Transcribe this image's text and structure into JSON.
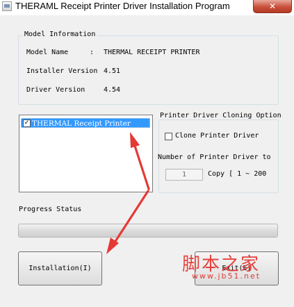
{
  "window": {
    "title": "THERAML Receipt Printer Driver Installation Program",
    "close_glyph": "✕"
  },
  "model_info": {
    "legend": "Model Information",
    "rows": [
      {
        "label": "Model Name",
        "sep": ":",
        "value": "THERMAL RECEIPT PRINTER"
      },
      {
        "label": "Installer Version",
        "value": "4.51"
      },
      {
        "label": "Driver Version",
        "value": "4.54"
      }
    ]
  },
  "printer_list": {
    "items": [
      {
        "label": "THERMAL Receipt Printer",
        "checked": true,
        "selected": true
      }
    ]
  },
  "cloning": {
    "legend": "Printer Driver Cloning Option",
    "clone_label": "Clone Printer Driver",
    "count_label": "Number of Printer Driver to",
    "count_value": "1",
    "copy_range": "Copy [ 1 ~ 200"
  },
  "progress": {
    "label": "Progress Status",
    "value": 0
  },
  "buttons": {
    "install": "Installation(I)",
    "exit": "Exit(E)"
  },
  "watermark": {
    "text": "脚本之家",
    "url": "www.jb51.net"
  },
  "colors": {
    "selection": "#3399ff",
    "arrow": "#e53935",
    "close": "#c9503b"
  }
}
